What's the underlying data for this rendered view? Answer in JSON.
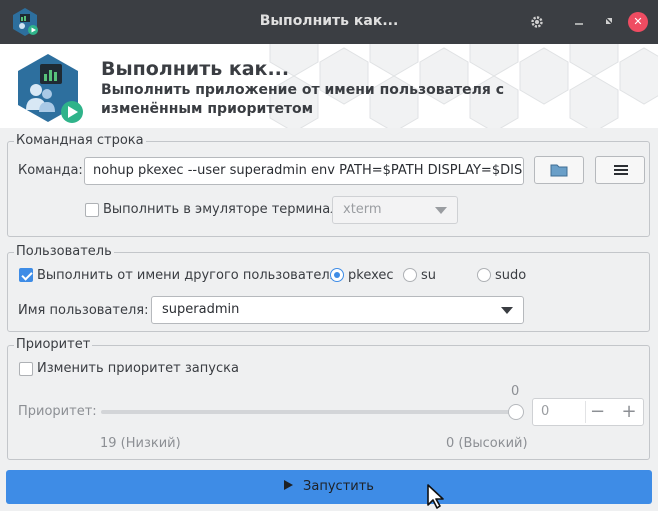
{
  "window": {
    "title": "Выполнить как...",
    "controls": {
      "settings_icon": "gear-icon",
      "minimize_icon": "minimize-icon",
      "maximize_icon": "maximize-icon",
      "close_icon": "close-icon"
    }
  },
  "header": {
    "title": "Выполнить как...",
    "subtitle": "Выполнить приложение от имени пользователя с изменённым приоритетом"
  },
  "command_group": {
    "label": "Командная строка",
    "command_label": "Команда:",
    "command_value": "nohup pkexec --user superadmin env PATH=$PATH DISPLAY=$DISPLAY",
    "browse_icon": "folder-icon",
    "menu_icon": "hamburger-menu-icon",
    "terminal_checkbox_label": "Выполнить в эмуляторе терминала",
    "terminal_checked": false,
    "terminal_select_value": "xterm"
  },
  "user_group": {
    "label": "Пользователь",
    "run_as_label": "Выполнить от имени другого пользователя:",
    "run_as_checked": true,
    "methods": [
      {
        "label": "pkexec",
        "selected": true
      },
      {
        "label": "su",
        "selected": false
      },
      {
        "label": "sudo",
        "selected": false
      }
    ],
    "username_label": "Имя пользователя:",
    "username_value": "superadmin"
  },
  "priority_group": {
    "label": "Приоритет",
    "change_label": "Изменить приоритет запуска",
    "change_checked": false,
    "priority_label": "Приоритет:",
    "slider_value_label": "0",
    "slider_value": 0,
    "slider_min": 19,
    "slider_max": 0,
    "min_label": "19 (Низкий)",
    "max_label": "0 (Высокий)",
    "spin_value": "0",
    "minus": "−",
    "plus": "+"
  },
  "run_button": {
    "label": "Запустить",
    "icon": "play-icon"
  },
  "colors": {
    "accent": "#3e8ce6",
    "titlebar": "#3b3e43",
    "close": "#ef4c62",
    "background": "#eff0f1"
  }
}
